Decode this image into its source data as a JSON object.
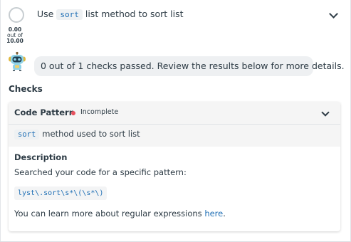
{
  "score": {
    "value": "0.00",
    "out_of_label": "out of",
    "max": "10.00"
  },
  "task": {
    "prefix": "Use",
    "code": "sort",
    "suffix": "list method to sort list"
  },
  "bot_message": "0 out of 1 checks passed. Review the results below for more details.",
  "checks_title": "Checks",
  "check": {
    "name": "Code Pattern",
    "status": "Incomplete",
    "status_color": "#e8525f",
    "summary_code": "sort",
    "summary_text": "method used to sort list",
    "description_title": "Description",
    "description_text": "Searched your code for a specific pattern:",
    "pattern": "lyst\\.sort\\s*\\(\\s*\\)",
    "learn_prefix": "You can learn more about regular expressions",
    "learn_link": "here",
    "learn_suffix": "."
  },
  "icons": {
    "task_toggle": "chevron-down-icon",
    "check_toggle": "chevron-down-icon",
    "bot": "robot-avatar-icon",
    "score": "score-circle-icon"
  },
  "colors": {
    "accent": "#1f6fb5",
    "text": "#2d3b45",
    "bubble": "#eef0f2",
    "status_incomplete": "#e8525f"
  }
}
